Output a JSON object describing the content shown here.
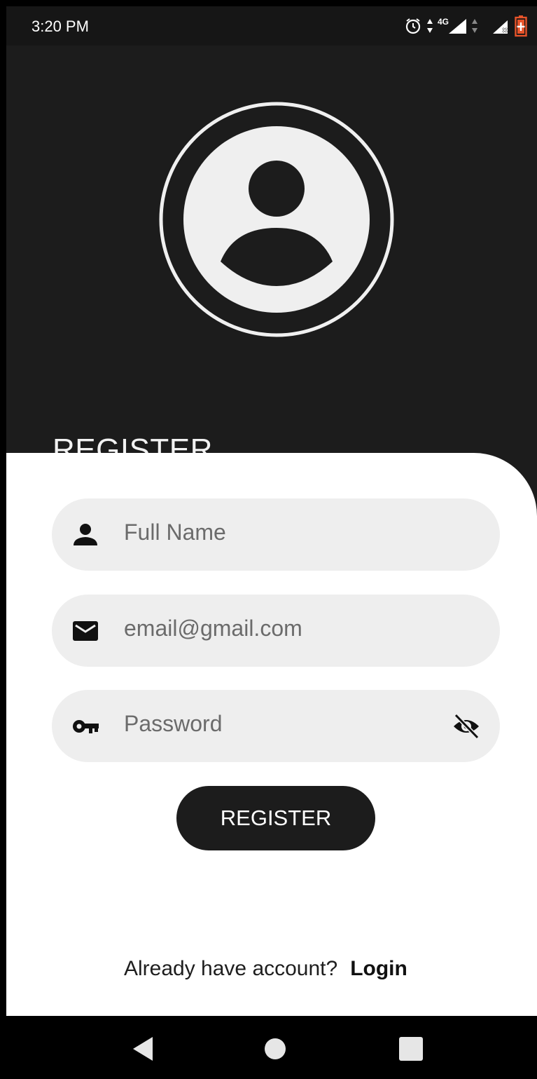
{
  "status_bar": {
    "time": "3:20 PM",
    "icons": [
      "alarm-icon",
      "data-arrows-icon",
      "4g-signal-icon",
      "data-arrows-icon",
      "no-sim-signal-icon",
      "battery-charging-icon"
    ],
    "network_label": "4G"
  },
  "header": {
    "avatar_icon": "account-circle-icon",
    "title": "REGISTER"
  },
  "form": {
    "full_name": {
      "placeholder": "Full Name",
      "icon": "person-icon"
    },
    "email": {
      "placeholder": "email@gmail.com",
      "icon": "mail-icon"
    },
    "password": {
      "placeholder": "Password",
      "icon": "key-icon",
      "trailing_icon": "visibility-off-icon"
    },
    "submit_label": "REGISTER"
  },
  "footer": {
    "prompt": "Already have account?",
    "link_label": "Login"
  },
  "nav_bar": {
    "buttons": [
      "back-icon",
      "home-icon",
      "recents-icon"
    ]
  },
  "colors": {
    "dark": "#1c1c1c",
    "field_bg": "#eeeeee",
    "card_bg": "#ffffff",
    "battery_accent": "#e8542a"
  }
}
